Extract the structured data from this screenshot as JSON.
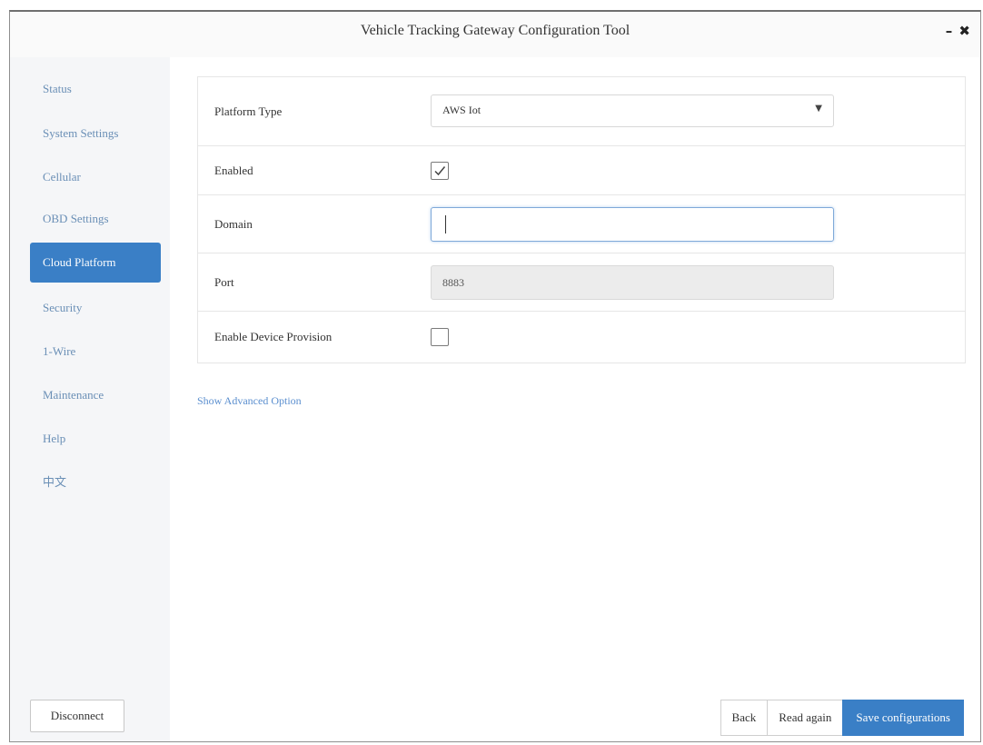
{
  "window": {
    "title": "Vehicle Tracking Gateway Configuration Tool",
    "minimize": "–",
    "close": "✖"
  },
  "sidebar": {
    "items": [
      {
        "label": "Status"
      },
      {
        "label": "System Settings"
      },
      {
        "label": "Cellular"
      },
      {
        "label": "OBD Settings"
      },
      {
        "label": "Cloud Platform",
        "active": true
      },
      {
        "label": "Security"
      },
      {
        "label": "1-Wire"
      },
      {
        "label": "Maintenance"
      },
      {
        "label": "Help"
      },
      {
        "label": "中文"
      }
    ],
    "disconnect_label": "Disconnect"
  },
  "form": {
    "platform_type": {
      "label": "Platform Type",
      "value": "AWS Iot"
    },
    "enabled": {
      "label": "Enabled",
      "checked": true
    },
    "domain": {
      "label": "Domain",
      "value": ""
    },
    "port": {
      "label": "Port",
      "value": "8883"
    },
    "enable_device_provision": {
      "label": "Enable Device Provision",
      "checked": false
    }
  },
  "advanced_link": "Show Advanced Option",
  "buttons": {
    "back": "Back",
    "read_again": "Read again",
    "save": "Save configurations"
  },
  "colors": {
    "accent": "#3a7fc6",
    "link": "#5b8fcf",
    "sidebar_bg": "#f5f6f8"
  }
}
